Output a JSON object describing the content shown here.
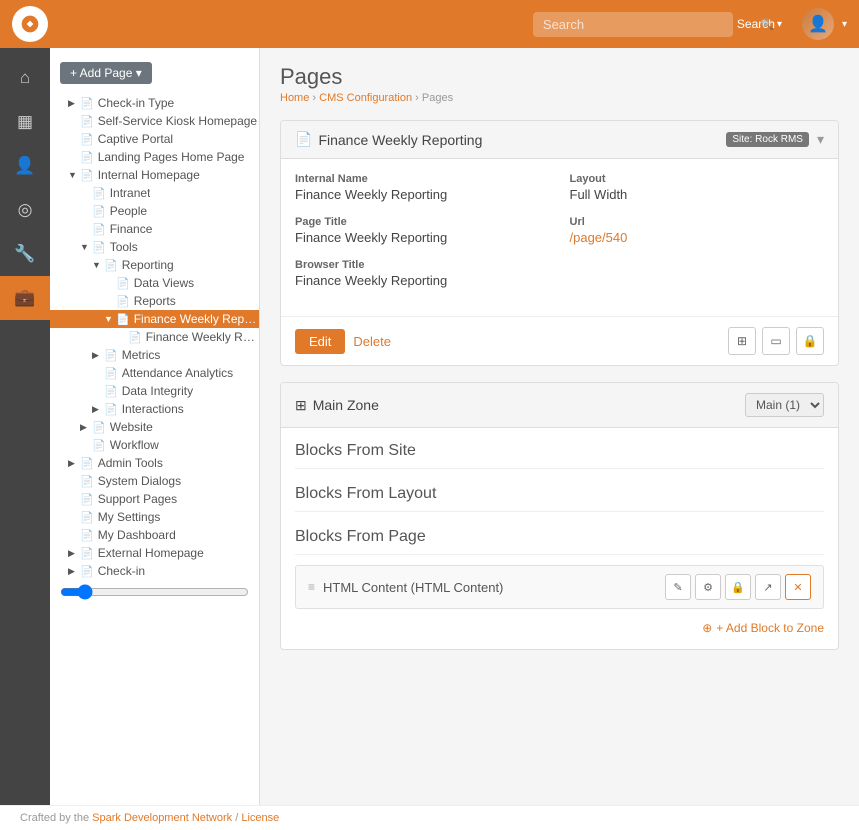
{
  "topNav": {
    "search_placeholder": "Search",
    "search_label": "Search",
    "caret": "▾"
  },
  "breadcrumb": {
    "home": "Home",
    "cms": "CMS Configuration",
    "current": "Pages"
  },
  "pageTitle": "Pages",
  "addPageButton": "+ Add Page ▾",
  "sidebar_icons": [
    {
      "name": "home-icon",
      "icon": "⌂",
      "active": false
    },
    {
      "name": "dashboard-icon",
      "icon": "▦",
      "active": false
    },
    {
      "name": "people-icon",
      "icon": "👤",
      "active": false
    },
    {
      "name": "money-icon",
      "icon": "◎",
      "active": false
    },
    {
      "name": "tools-icon",
      "icon": "🔧",
      "active": false
    },
    {
      "name": "briefcase-icon",
      "icon": "💼",
      "active": true
    }
  ],
  "treeItems": [
    {
      "id": "check-in-type",
      "label": "Check-in Type",
      "indent": "indent1",
      "hasArrow": true,
      "active": false
    },
    {
      "id": "self-service-kiosk",
      "label": "Self-Service Kiosk Homepage",
      "indent": "indent1",
      "hasArrow": false,
      "active": false
    },
    {
      "id": "captive-portal",
      "label": "Captive Portal",
      "indent": "indent1",
      "hasArrow": false,
      "active": false
    },
    {
      "id": "landing-pages",
      "label": "Landing Pages Home Page",
      "indent": "indent1",
      "hasArrow": false,
      "active": false
    },
    {
      "id": "internal-homepage",
      "label": "Internal Homepage",
      "indent": "indent1",
      "hasArrow": true,
      "open": true,
      "active": false
    },
    {
      "id": "intranet",
      "label": "Intranet",
      "indent": "indent2",
      "hasArrow": false,
      "active": false
    },
    {
      "id": "people",
      "label": "People",
      "indent": "indent2",
      "hasArrow": false,
      "active": false
    },
    {
      "id": "finance",
      "label": "Finance",
      "indent": "indent2",
      "hasArrow": false,
      "active": false
    },
    {
      "id": "tools",
      "label": "Tools",
      "indent": "indent2",
      "hasArrow": true,
      "open": true,
      "active": false
    },
    {
      "id": "reporting",
      "label": "Reporting",
      "indent": "indent3",
      "hasArrow": true,
      "open": true,
      "active": false
    },
    {
      "id": "data-views",
      "label": "Data Views",
      "indent": "indent4",
      "hasArrow": false,
      "active": false
    },
    {
      "id": "reports",
      "label": "Reports",
      "indent": "indent4",
      "hasArrow": false,
      "active": false
    },
    {
      "id": "finance-weekly-reporting-parent",
      "label": "Finance Weekly Reporting",
      "indent": "indent4",
      "hasArrow": true,
      "open": true,
      "active": true
    },
    {
      "id": "finance-weekly-report-child",
      "label": "Finance Weekly Report",
      "indent": "indent5",
      "hasArrow": false,
      "active": false
    },
    {
      "id": "metrics",
      "label": "Metrics",
      "indent": "indent3",
      "hasArrow": true,
      "active": false
    },
    {
      "id": "attendance-analytics",
      "label": "Attendance Analytics",
      "indent": "indent3",
      "hasArrow": false,
      "active": false
    },
    {
      "id": "data-integrity",
      "label": "Data Integrity",
      "indent": "indent3",
      "hasArrow": false,
      "active": false
    },
    {
      "id": "interactions",
      "label": "Interactions",
      "indent": "indent3",
      "hasArrow": true,
      "active": false
    },
    {
      "id": "website",
      "label": "Website",
      "indent": "indent2",
      "hasArrow": true,
      "active": false
    },
    {
      "id": "workflow",
      "label": "Workflow",
      "indent": "indent2",
      "hasArrow": false,
      "active": false
    },
    {
      "id": "admin-tools",
      "label": "Admin Tools",
      "indent": "indent1",
      "hasArrow": true,
      "active": false
    },
    {
      "id": "system-dialogs",
      "label": "System Dialogs",
      "indent": "indent1",
      "hasArrow": false,
      "active": false
    },
    {
      "id": "support-pages",
      "label": "Support Pages",
      "indent": "indent1",
      "hasArrow": false,
      "active": false
    },
    {
      "id": "my-settings",
      "label": "My Settings",
      "indent": "indent1",
      "hasArrow": false,
      "active": false
    },
    {
      "id": "my-dashboard",
      "label": "My Dashboard",
      "indent": "indent1",
      "hasArrow": false,
      "active": false
    },
    {
      "id": "external-homepage",
      "label": "External Homepage",
      "indent": "indent1",
      "hasArrow": true,
      "active": false
    },
    {
      "id": "check-in",
      "label": "Check-in",
      "indent": "indent1",
      "hasArrow": true,
      "active": false
    }
  ],
  "detailPanel": {
    "title": "Finance Weekly Reporting",
    "titleIcon": "📄",
    "siteBadge": "Site: Rock RMS",
    "fields": {
      "internalNameLabel": "Internal Name",
      "internalNameValue": "Finance Weekly Reporting",
      "layoutLabel": "Layout",
      "layoutValue": "Full Width",
      "pageTitleLabel": "Page Title",
      "pageTitleValue": "Finance Weekly Reporting",
      "urlLabel": "Url",
      "urlValue": "/page/540",
      "browserTitleLabel": "Browser Title",
      "browserTitleValue": "Finance Weekly Reporting"
    },
    "editButton": "Edit",
    "deleteButton": "Delete"
  },
  "mainZone": {
    "title": "Main Zone",
    "titleIcon": "⊞",
    "selectLabel": "Main (1)",
    "blocksFromSite": "Blocks From Site",
    "blocksFromLayout": "Blocks From Layout",
    "blocksFromPage": "Blocks From Page",
    "blockItem": {
      "dragIcon": "≡",
      "name": "HTML Content (HTML Content)"
    },
    "addBlockLabel": "+ Add Block to Zone"
  },
  "footer": {
    "text": "Crafted by the",
    "linkText": "Spark Development Network",
    "separator": "/",
    "licenseText": "License"
  }
}
